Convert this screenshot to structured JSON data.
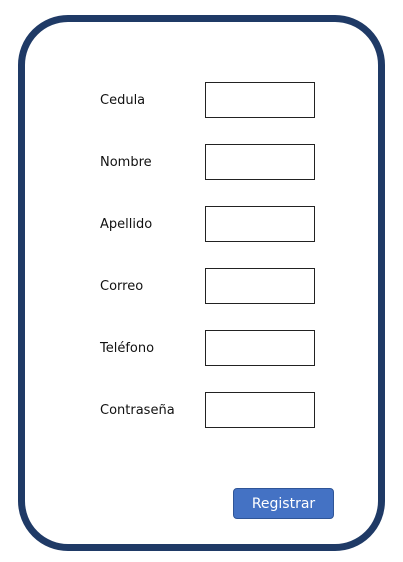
{
  "form": {
    "fields": [
      {
        "label": "Cedula",
        "value": "",
        "placeholder": ""
      },
      {
        "label": "Nombre",
        "value": "",
        "placeholder": ""
      },
      {
        "label": "Apellido",
        "value": "",
        "placeholder": ""
      },
      {
        "label": "Correo",
        "value": "",
        "placeholder": ""
      },
      {
        "label": "Teléfono",
        "value": "",
        "placeholder": ""
      },
      {
        "label": "Contraseña",
        "value": "",
        "placeholder": ""
      }
    ],
    "submit_label": "Registrar"
  },
  "colors": {
    "frame_border": "#1f3a66",
    "button_background": "#4472c4",
    "button_border": "#2f5597",
    "button_text": "#ffffff"
  }
}
